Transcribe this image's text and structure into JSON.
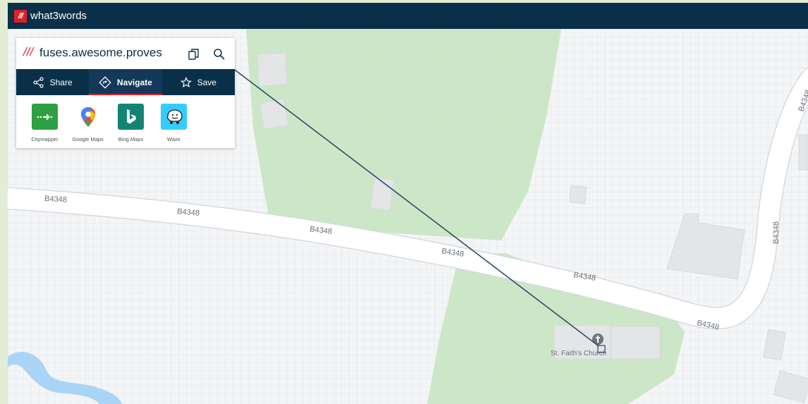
{
  "header": {
    "logo_mark": "///",
    "brand": "what3words"
  },
  "address": {
    "slashes": "///",
    "words": "fuses.awesome.proves"
  },
  "actions": {
    "copy_icon": "copy-icon",
    "search_icon": "search-icon"
  },
  "tabs": [
    {
      "label": "Share",
      "icon": "share-icon",
      "active": false
    },
    {
      "label": "Navigate",
      "icon": "navigate-icon",
      "active": true
    },
    {
      "label": "Save",
      "icon": "star-icon",
      "active": false
    }
  ],
  "apps": [
    {
      "label": "Citymapper",
      "color": "#2ea043"
    },
    {
      "label": "Google Maps",
      "color": "#ffffff"
    },
    {
      "label": "Bing Maps",
      "color": "#138473"
    },
    {
      "label": "Waze",
      "color": "#33ccff"
    }
  ],
  "map": {
    "road_labels": [
      "B4348",
      "B4348",
      "B4348",
      "B4348",
      "B4348",
      "B4348",
      "B4348",
      "B4348",
      "B434"
    ],
    "poi": "St. Faith's Church",
    "colors": {
      "park": "#c9e6c4",
      "water": "#a9d4f5",
      "road": "#ffffff",
      "building": "#e3e5e7",
      "grid": "#dde2e8",
      "pointer": "#2f4c63"
    }
  }
}
